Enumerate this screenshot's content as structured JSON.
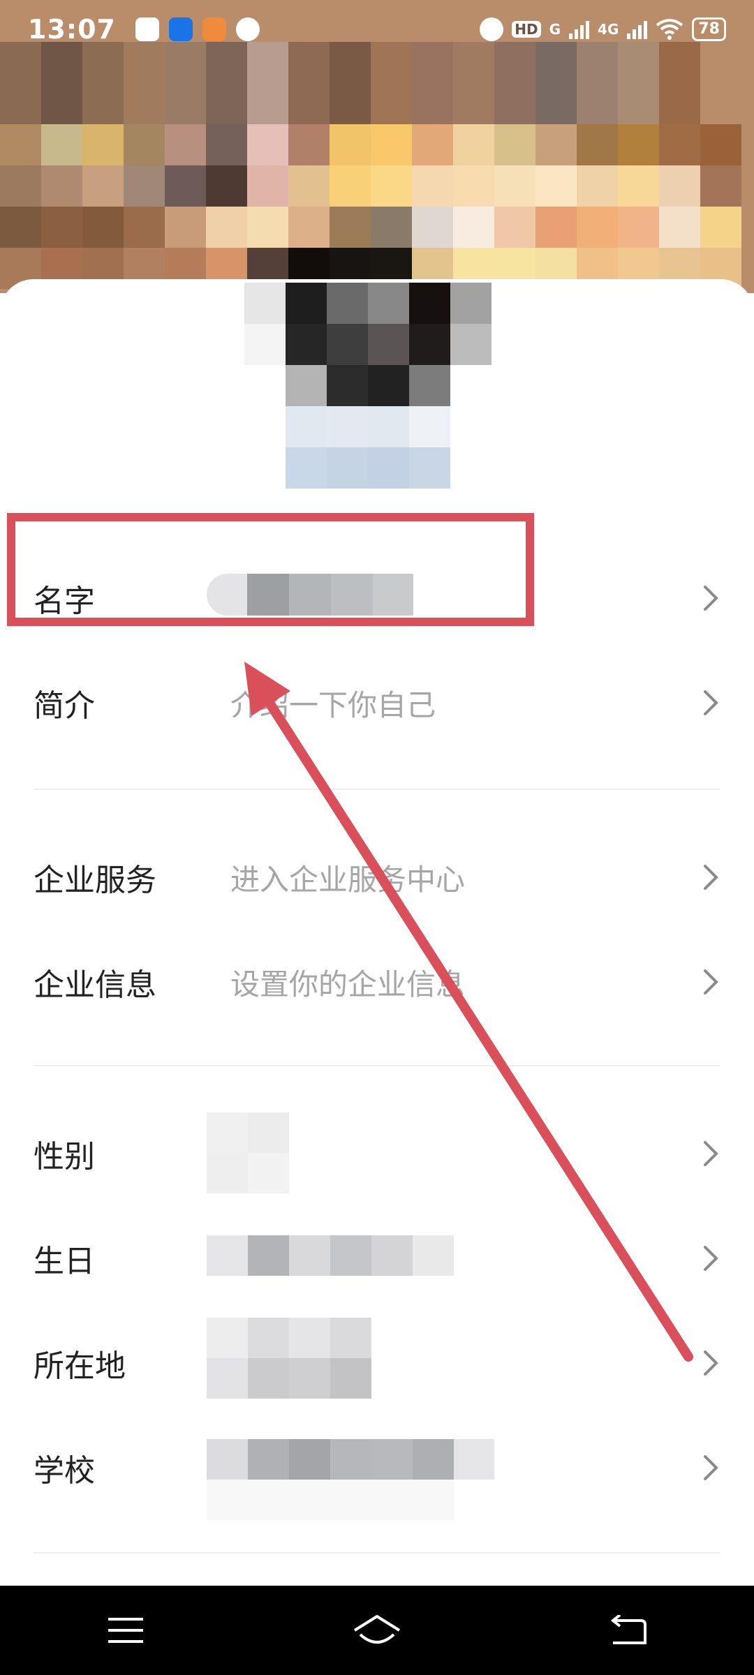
{
  "status_bar": {
    "time": "13:07",
    "network": "4G",
    "hd_label": "HD",
    "g_label": "G",
    "battery": "78"
  },
  "profile_rows": [
    {
      "label": "名字",
      "value": ""
    },
    {
      "label": "简介",
      "value": "介绍一下你自己"
    },
    {
      "label": "企业服务",
      "value": "进入企业服务中心"
    },
    {
      "label": "企业信息",
      "value": "设置你的企业信息"
    },
    {
      "label": "性别",
      "value": ""
    },
    {
      "label": "生日",
      "value": ""
    },
    {
      "label": "所在地",
      "value": ""
    },
    {
      "label": "学校",
      "value": ""
    }
  ],
  "icons": {
    "chevron": "chevron-right-icon",
    "menu": "menu-icon",
    "home": "home-icon",
    "back": "back-icon"
  },
  "colors": {
    "annotation": "#d9505a",
    "label": "#222222",
    "placeholder": "#a6a6a6",
    "navbar": "#000000"
  }
}
